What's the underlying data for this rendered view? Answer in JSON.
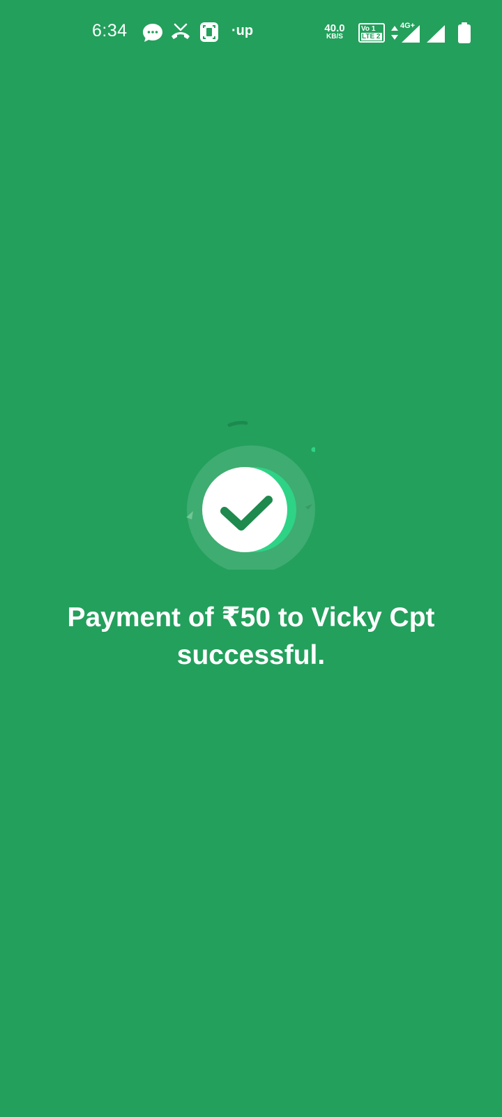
{
  "status_bar": {
    "time": "6:34",
    "extra_app_label": "·up",
    "net_speed_value": "40.0",
    "net_speed_unit": "KB/S",
    "volte_top": "Vo 1",
    "volte_bottom": "LTE 2",
    "network_type": "4G+",
    "icons": [
      "messages-icon",
      "missed-call-icon",
      "screenshot-icon",
      "data-arrows-icon",
      "signal-icon",
      "signal-icon",
      "battery-icon"
    ]
  },
  "payment": {
    "line1": "Payment of ₹50 to Vicky Cpt",
    "line2": "successful.",
    "icon": "checkmark-icon"
  },
  "colors": {
    "background": "#23a05c",
    "check": "#1e8a4e",
    "accent": "#2ed386"
  }
}
